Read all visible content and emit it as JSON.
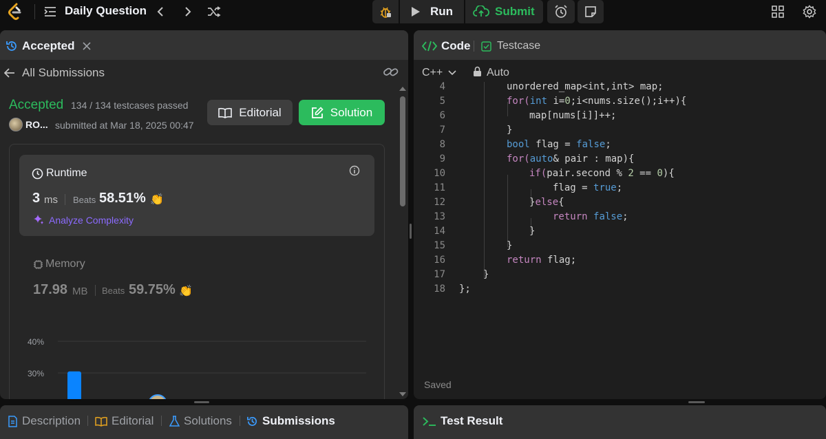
{
  "topbar": {
    "title": "Daily Question",
    "run_label": "Run",
    "submit_label": "Submit"
  },
  "left_panel": {
    "tab_label": "Accepted",
    "back_label": "All Submissions",
    "status": "Accepted",
    "testcases": "134 / 134 testcases passed",
    "user": "RO...",
    "submitted": "submitted at Mar 18, 2025 00:47",
    "editorial_label": "Editorial",
    "solution_label": "Solution",
    "runtime": {
      "title": "Runtime",
      "value": "3",
      "unit": "ms",
      "beats_label": "Beats",
      "beats_value": "58.51%",
      "analyze_label": "Analyze Complexity"
    },
    "memory": {
      "title": "Memory",
      "value": "17.98",
      "unit": "MB",
      "beats_label": "Beats",
      "beats_value": "59.75%"
    }
  },
  "chart_data": {
    "type": "bar",
    "y_ticks": [
      "40%",
      "30%"
    ],
    "values": [
      30.5
    ],
    "ylim": [
      0,
      40
    ]
  },
  "right_panel": {
    "code_tab": "Code",
    "testcase_tab": "Testcase",
    "language": "C++",
    "auto_label": "Auto",
    "saved_label": "Saved",
    "test_result_label": "Test Result"
  },
  "bottom_tabs": {
    "description": "Description",
    "editorial": "Editorial",
    "solutions": "Solutions",
    "submissions": "Submissions"
  },
  "code": {
    "lines": [
      {
        "n": "4"
      },
      {
        "n": "5"
      },
      {
        "n": "6"
      },
      {
        "n": "7"
      },
      {
        "n": "8"
      },
      {
        "n": "9"
      },
      {
        "n": "10"
      },
      {
        "n": "11"
      },
      {
        "n": "12"
      },
      {
        "n": "13"
      },
      {
        "n": "14"
      },
      {
        "n": "15"
      },
      {
        "n": "16"
      },
      {
        "n": "17"
      },
      {
        "n": "18"
      }
    ],
    "text": {
      "l4": "unordered_map<int,int> map;",
      "l5a": "for(",
      "l5b": "int",
      "l5c": " i=",
      "l5d": "0",
      "l5e": ";i<nums.size();i++){",
      "l6": "map[nums[i]]++;",
      "l7": "}",
      "l8a": "bool",
      "l8b": " flag = ",
      "l8c": "false",
      "l8d": ";",
      "l9a": "for(",
      "l9b": "auto",
      "l9c": "& pair : map){",
      "l10a": "if(",
      "l10b": "pair.second % ",
      "l10c": "2",
      "l10d": " == ",
      "l10e": "0",
      "l10f": "){",
      "l11a": "flag = ",
      "l11b": "true",
      "l11c": ";",
      "l12a": "}",
      "l12b": "else",
      "l12c": "{",
      "l13a": "return",
      "l13b": " ",
      "l13c": "false",
      "l13d": ";",
      "l14": "}",
      "l15": "}",
      "l16a": "return",
      "l16b": " flag;",
      "l17": "}",
      "l18": "};"
    }
  }
}
